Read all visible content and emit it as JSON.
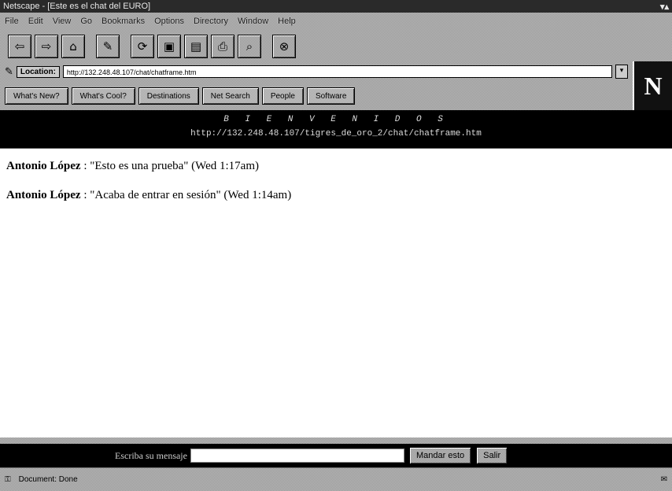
{
  "window": {
    "title": "Netscape - [Este es el chat del EURO]",
    "controls": "▾▴"
  },
  "menu": [
    "File",
    "Edit",
    "View",
    "Go",
    "Bookmarks",
    "Options",
    "Directory",
    "Window",
    "Help"
  ],
  "toolbar": [
    {
      "icon": "back-icon",
      "glyph": "⇦"
    },
    {
      "icon": "forward-icon",
      "glyph": "⇨"
    },
    {
      "icon": "home-icon",
      "glyph": "⌂"
    },
    {
      "icon": "edit-icon",
      "glyph": "✎"
    },
    {
      "icon": "reload-icon",
      "glyph": "⟳"
    },
    {
      "icon": "images-icon",
      "glyph": "▣"
    },
    {
      "icon": "open-icon",
      "glyph": "▤"
    },
    {
      "icon": "print-icon",
      "glyph": "⎙"
    },
    {
      "icon": "find-icon",
      "glyph": "⌕"
    },
    {
      "icon": "stop-icon",
      "glyph": "⊗"
    }
  ],
  "location": {
    "label": "Location:",
    "url": "http://132.248.48.107/chat/chatframe.htm"
  },
  "directory_buttons": [
    "What's New?",
    "What's Cool?",
    "Destinations",
    "Net Search",
    "People",
    "Software"
  ],
  "logo": "N",
  "banner": {
    "line1": "B I E N V E N I D O S",
    "line2": "http://132.248.48.107/tigres_de_oro_2/chat/chatframe.htm"
  },
  "messages": [
    {
      "author": "Antonio López",
      "text": " : \"Esto es una prueba\" (Wed 1:17am)"
    },
    {
      "author": "Antonio López",
      "text": " : \"Acaba de entrar en sesión\" (Wed 1:14am)"
    }
  ],
  "chat_input": {
    "label": "Escriba su mensaje",
    "value": "",
    "send_label": "Mandar esto",
    "exit_label": "Salir"
  },
  "status": {
    "text": "Document: Done"
  }
}
